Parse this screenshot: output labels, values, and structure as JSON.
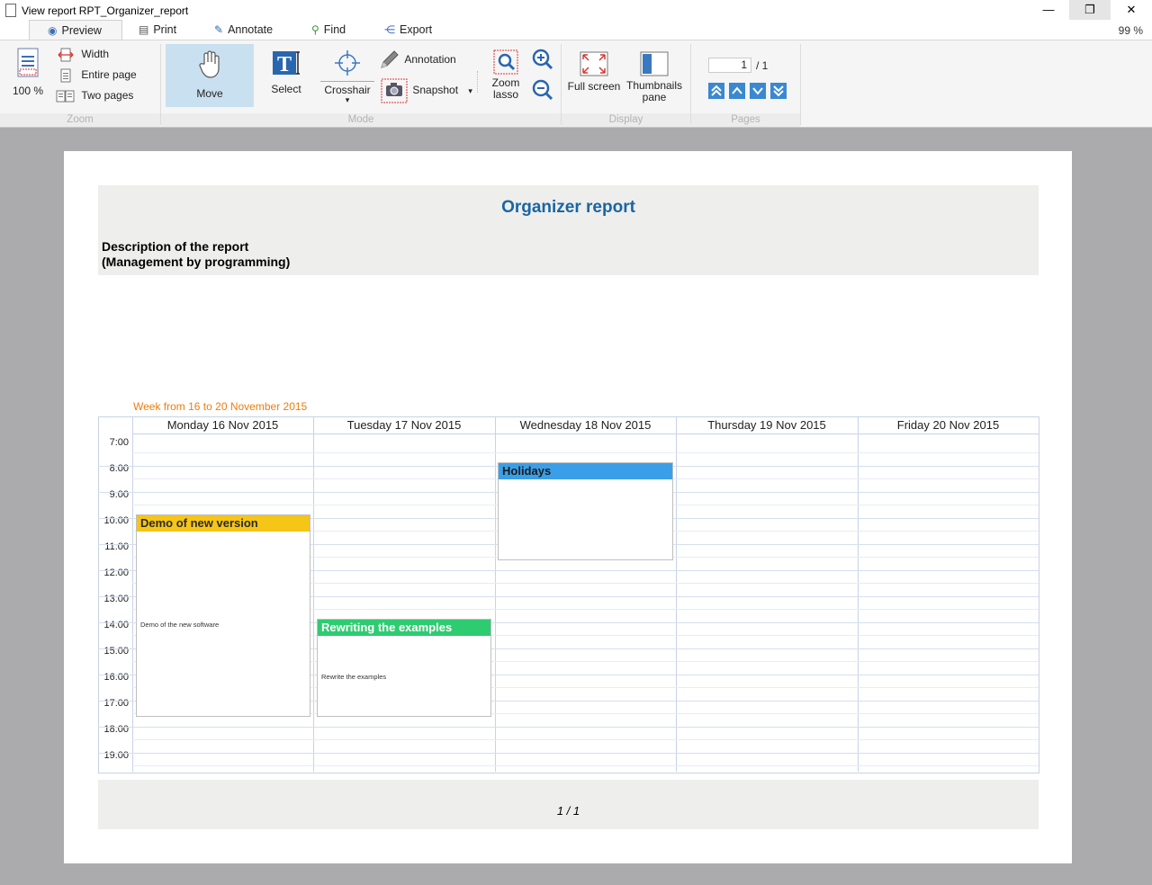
{
  "window": {
    "title": "View report RPT_Organizer_report",
    "minimize": "—",
    "restore": "❐",
    "close": "✕"
  },
  "tabs": [
    {
      "label": "Preview",
      "icon": "eye-icon",
      "glyph": "◉"
    },
    {
      "label": "Print",
      "icon": "printer-icon",
      "glyph": "▤"
    },
    {
      "label": "Annotate",
      "icon": "pencil-icon",
      "glyph": "✎"
    },
    {
      "label": "Find",
      "icon": "magnifier-icon",
      "glyph": "⚲"
    },
    {
      "label": "Export",
      "icon": "share-icon",
      "glyph": "⋲"
    }
  ],
  "zoom_level": "99 %",
  "ribbon": {
    "zoom": {
      "label": "Zoom",
      "percent": "100 %",
      "width": "Width",
      "entire_page": "Entire page",
      "two_pages": "Two pages"
    },
    "mode": {
      "label": "Mode",
      "move": "Move",
      "select": "Select",
      "crosshair": "Crosshair",
      "annotation": "Annotation",
      "snapshot": "Snapshot",
      "zoom_lasso_1": "Zoom",
      "zoom_lasso_2": "lasso",
      "dropdown": "▾"
    },
    "display": {
      "label": "Display",
      "full_screen": "Full screen",
      "thumbnails_1": "Thumbnails",
      "thumbnails_2": "pane"
    },
    "pages": {
      "label": "Pages",
      "current": "1",
      "total": "/ 1"
    }
  },
  "report": {
    "title": "Organizer report",
    "desc_line1": "Description of the report",
    "desc_line2": "(Management by programming)",
    "week": "Week from 16  to 20 November 2015",
    "days": [
      "Monday 16 Nov 2015",
      "Tuesday 17 Nov 2015",
      "Wednesday 18 Nov 2015",
      "Thursday 19 Nov 2015",
      "Friday 20 Nov 2015"
    ],
    "hours": [
      "7:00",
      "8:00",
      "9:00",
      "10:00",
      "11:00",
      "12:00",
      "13:00",
      "14:00",
      "15:00",
      "16:00",
      "17:00",
      "18:00",
      "19:00"
    ],
    "events": [
      {
        "title": "Demo of new version",
        "body": "Demo of the new software",
        "color": "#f5c518",
        "text_color": "#2b2b2b"
      },
      {
        "title": "Rewriting the examples",
        "body": "Rewrite the examples",
        "color": "#2ecc71",
        "text_color": "#ffffff"
      },
      {
        "title": "Holidays",
        "body": "",
        "color": "#3a9fe8",
        "text_color": "#1a1a1a"
      }
    ],
    "footer_page": "1  /  1"
  }
}
